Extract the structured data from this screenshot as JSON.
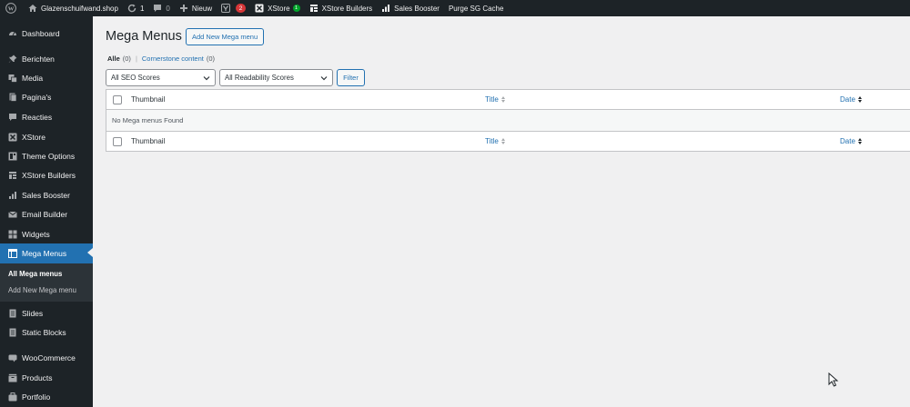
{
  "adminbar": {
    "site_name": "Glazenschuifwand.shop",
    "updates_count": "1",
    "comments_count": "0",
    "new_label": "Nieuw",
    "yoast_badge": "2",
    "xstore_label": "XStore",
    "xstore_badge": "1",
    "xstore_builders_label": "XStore Builders",
    "sales_booster_label": "Sales Booster",
    "purge_cache_label": "Purge SG Cache"
  },
  "sidebar": {
    "items": [
      {
        "label": "Dashboard",
        "icon": "dashboard-icon"
      },
      {
        "label": "Berichten",
        "icon": "pin-icon"
      },
      {
        "label": "Media",
        "icon": "media-icon"
      },
      {
        "label": "Pagina's",
        "icon": "page-icon"
      },
      {
        "label": "Reacties",
        "icon": "comment-icon"
      },
      {
        "label": "XStore",
        "icon": "xstore-icon"
      },
      {
        "label": "Theme Options",
        "icon": "theme-options-icon"
      },
      {
        "label": "XStore Builders",
        "icon": "builders-icon"
      },
      {
        "label": "Sales Booster",
        "icon": "bar-chart-icon"
      },
      {
        "label": "Email Builder",
        "icon": "email-icon"
      },
      {
        "label": "Widgets",
        "icon": "widgets-icon"
      },
      {
        "label": "Mega Menus",
        "icon": "mega-menu-icon"
      },
      {
        "label": "Slides",
        "icon": "slides-icon"
      },
      {
        "label": "Static Blocks",
        "icon": "static-blocks-icon"
      },
      {
        "label": "WooCommerce",
        "icon": "woo-icon"
      },
      {
        "label": "Products",
        "icon": "products-icon"
      },
      {
        "label": "Portfolio",
        "icon": "portfolio-icon"
      }
    ],
    "submenu": {
      "all_label": "All Mega menus",
      "add_label": "Add New Mega menu"
    }
  },
  "main": {
    "title": "Mega Menus",
    "add_new_label": "Add New Mega menu",
    "views": {
      "all_label": "Alle",
      "all_count": "(0)",
      "separator": "|",
      "cornerstone_label": "Cornerstone content",
      "cornerstone_count": "(0)"
    },
    "filters": {
      "seo_selected": "All SEO Scores",
      "readability_selected": "All Readability Scores",
      "filter_label": "Filter"
    },
    "table": {
      "columns": [
        "Thumbnail",
        "Title",
        "Date"
      ],
      "empty_message": "No Mega menus Found"
    }
  },
  "colors": {
    "sidebar_bg": "#1d2327",
    "accent": "#2271b1",
    "content_bg": "#f0f0f1",
    "badge_red": "#d63638",
    "badge_green": "#00a32a"
  }
}
